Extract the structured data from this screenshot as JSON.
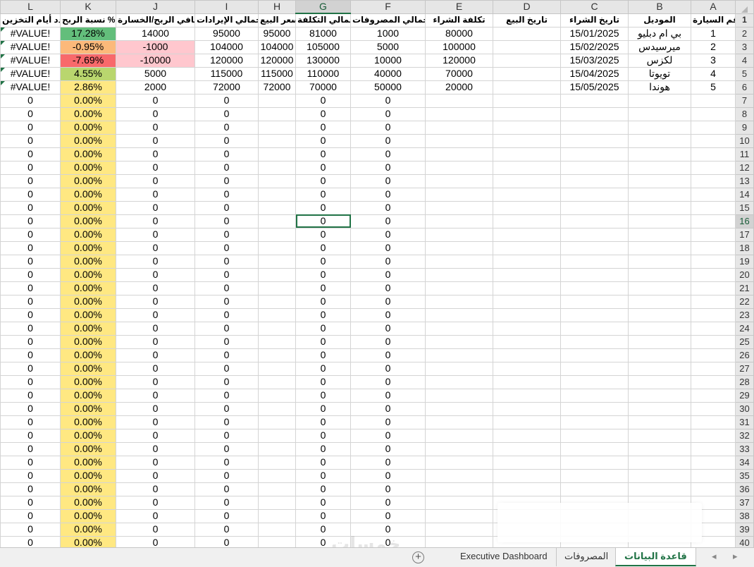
{
  "colors": {
    "green_fill": "#63be7b",
    "light_green_fill": "#b9d66e",
    "yellow_fill": "#ffe882",
    "orange_fill": "#fcb97a",
    "red_fill": "#f8696b",
    "pink_fill": "#ffc7ce",
    "selection": "#217346"
  },
  "columns": [
    "L",
    "K",
    "J",
    "I",
    "H",
    "G",
    "F",
    "E",
    "D",
    "C",
    "B",
    "A"
  ],
  "headers": [
    "عدد أيام التخزين",
    "نسبة الربح %",
    "صافي الربح/الخسارة",
    "إجمالي الإيرادات",
    "سعر البيع",
    "إجمالي التكلفة",
    "إجمالي المصروفات",
    "تكلفة الشراء",
    "تاريخ البيع",
    "تاريخ الشراء",
    "الموديل",
    "رقم السيارة"
  ],
  "data_rows": [
    {
      "L": "#VALUE!",
      "K": "17.28%",
      "J": "14000",
      "I": "95000",
      "H": "95000",
      "G": "81000",
      "F": "1000",
      "E": "80000",
      "D": "",
      "C": "15/01/2025",
      "B": "بي ام دبليو",
      "A": "1"
    },
    {
      "L": "#VALUE!",
      "K": "-0.95%",
      "J": "-1000",
      "I": "104000",
      "H": "104000",
      "G": "105000",
      "F": "5000",
      "E": "100000",
      "D": "",
      "C": "15/02/2025",
      "B": "ميرسيدس",
      "A": "2"
    },
    {
      "L": "#VALUE!",
      "K": "-7.69%",
      "J": "-10000",
      "I": "120000",
      "H": "120000",
      "G": "130000",
      "F": "10000",
      "E": "120000",
      "D": "",
      "C": "15/03/2025",
      "B": "لكزس",
      "A": "3"
    },
    {
      "L": "#VALUE!",
      "K": "4.55%",
      "J": "5000",
      "I": "115000",
      "H": "115000",
      "G": "110000",
      "F": "40000",
      "E": "70000",
      "D": "",
      "C": "15/04/2025",
      "B": "تويوتا",
      "A": "4"
    },
    {
      "L": "#VALUE!",
      "K": "2.86%",
      "J": "2000",
      "I": "72000",
      "H": "72000",
      "G": "70000",
      "F": "50000",
      "E": "20000",
      "D": "",
      "C": "15/05/2025",
      "B": "هوندا",
      "A": "5"
    }
  ],
  "empty_row_values": {
    "L": "0",
    "K": "0.00%",
    "J": "0",
    "I": "0",
    "H": "",
    "G": "0",
    "F": "0",
    "E": "",
    "D": "",
    "C": "",
    "B": "",
    "A": ""
  },
  "first_empty_row": 7,
  "last_row": 40,
  "selected_cell": {
    "col": "G",
    "row": 16
  },
  "sheet_tabs": [
    {
      "label": "قاعدة البيانات",
      "active": true
    },
    {
      "label": "المصروفات",
      "active": false
    },
    {
      "label": "Executive Dashboard",
      "active": false
    }
  ],
  "tab_nav": {
    "prev": "◂",
    "next": "▸"
  },
  "add_sheet_symbol": "+",
  "watermark_text": "خمسات"
}
